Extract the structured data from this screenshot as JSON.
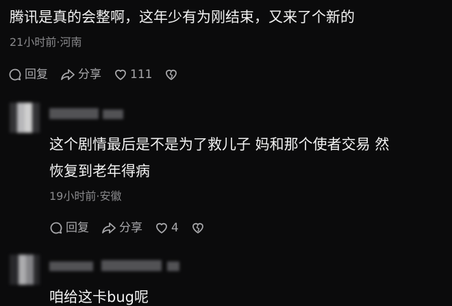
{
  "comments": [
    {
      "text": "腾讯是真的会整啊，这年少有为刚结束，又来了个新的",
      "meta": "21小时前·河南",
      "reply_label": "回复",
      "share_label": "分享",
      "like_count": "111"
    },
    {
      "text_line1": "这个剧情最后是不是为了救儿子 妈和那个使者交易 然",
      "text_line2": "恢复到老年得病",
      "meta": "19小时前·安徽",
      "reply_label": "回复",
      "share_label": "分享",
      "like_count": "4"
    },
    {
      "text": "咱给这卡bug呢"
    }
  ],
  "icons": {
    "reply": "comment-bubble-icon",
    "share": "share-arrow-icon",
    "like": "heart-icon",
    "dislike": "broken-heart-icon"
  }
}
